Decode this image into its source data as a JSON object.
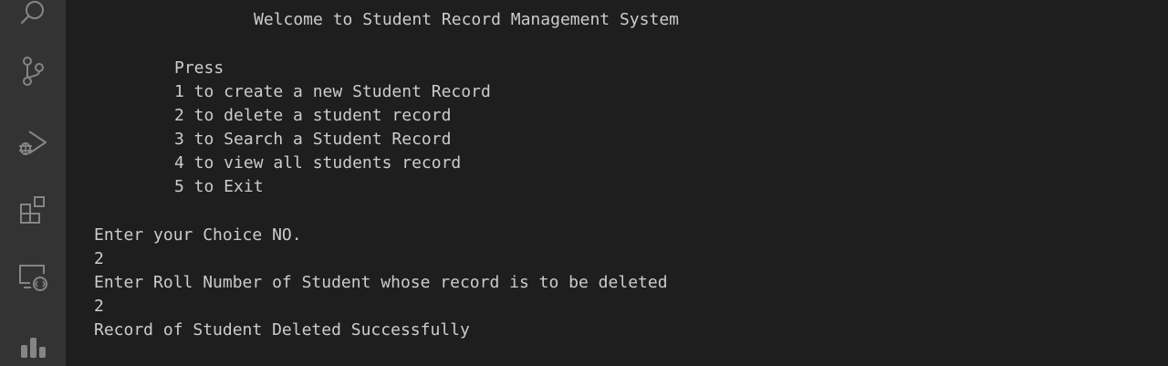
{
  "activity_bar": {
    "icons": [
      "search-icon",
      "source-control-icon",
      "run-debug-icon",
      "extensions-icon",
      "remote-explorer-icon",
      "charts-icon"
    ]
  },
  "terminal": {
    "lines": [
      "Welcome to Student Record Management System",
      "Press",
      "1 to create a new Student Record",
      "2 to delete a student record",
      "3 to Search a Student Record",
      "4 to view all students record",
      "5 to Exit",
      "Enter your Choice NO.",
      "2",
      "Enter Roll Number of Student whose record is to be deleted",
      "2",
      "Record of Student Deleted Successfully"
    ]
  },
  "colors": {
    "background": "#1e1e1e",
    "activity_bar": "#333333",
    "text": "#cccccc",
    "icon": "#858585"
  }
}
